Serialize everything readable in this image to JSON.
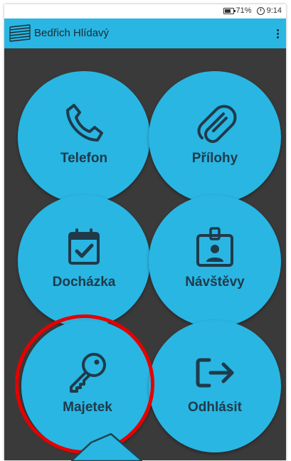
{
  "status_bar": {
    "battery": "71%",
    "time": "9:14"
  },
  "app_bar": {
    "title": "Bedřich Hlídavý",
    "menu_icon": "more-vert-icon"
  },
  "tiles": [
    {
      "label": "Telefon",
      "icon": "phone-icon"
    },
    {
      "label": "Přílohy",
      "icon": "paperclip-icon"
    },
    {
      "label": "Docházka",
      "icon": "calendar-check-icon"
    },
    {
      "label": "Návštěvy",
      "icon": "id-badge-icon"
    },
    {
      "label": "Majetek",
      "icon": "key-icon"
    },
    {
      "label": "Odhlásit",
      "icon": "logout-icon"
    }
  ],
  "colors": {
    "accent": "#29b6e3",
    "background": "#3a3a3a",
    "highlight": "#e60000",
    "label": "#1f3a4a"
  }
}
